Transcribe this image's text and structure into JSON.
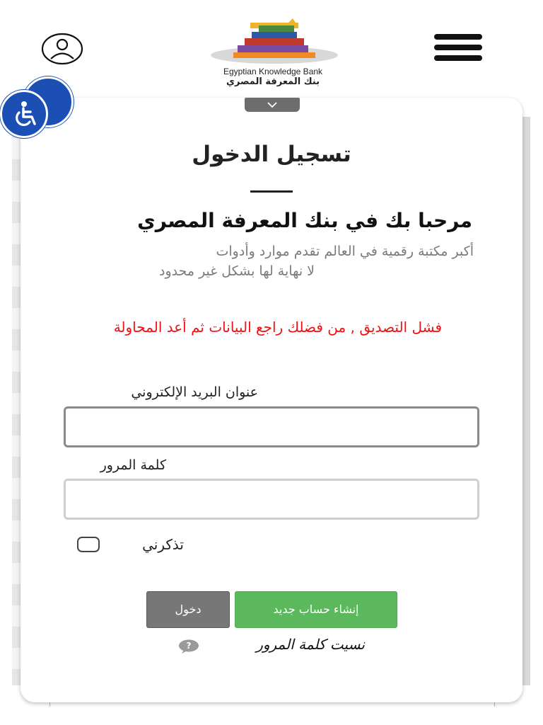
{
  "header": {
    "logo_text_en": "Egyptian Knowledge Bank",
    "logo_text_ar": "بنك المعرفة المصري"
  },
  "login": {
    "title": "تسجيل الدخول",
    "welcome": "مرحبا بك في بنك المعرفة المصري",
    "description_line1": "أكبر مكتبة رقمية في العالم تقدم موارد وأدوات",
    "description_line2": "لا نهاية لها بشكل غير محدود",
    "error_message": "فشل التصديق , من فضلك راجع البيانات ثم أعد المحاولة",
    "email_label": "عنوان البريد الإلكتروني",
    "email_value": "",
    "password_label": "كلمة المرور",
    "password_value": "",
    "remember_label": "تذكرني",
    "remember_checked": false,
    "login_button": "دخول",
    "register_button": "إنشاء حساب جديد",
    "forgot_password": "نسيت كلمة المرور"
  },
  "colors": {
    "accessibility_blue": "#1b4fb3",
    "error_red": "#ee1111",
    "register_green": "#5cb85c",
    "login_gray": "#777777"
  },
  "icons": {
    "user": "user-icon",
    "menu": "menu-icon",
    "dropdown": "chevron-down-icon",
    "accessibility": "wheelchair-icon",
    "help": "question-icon"
  }
}
